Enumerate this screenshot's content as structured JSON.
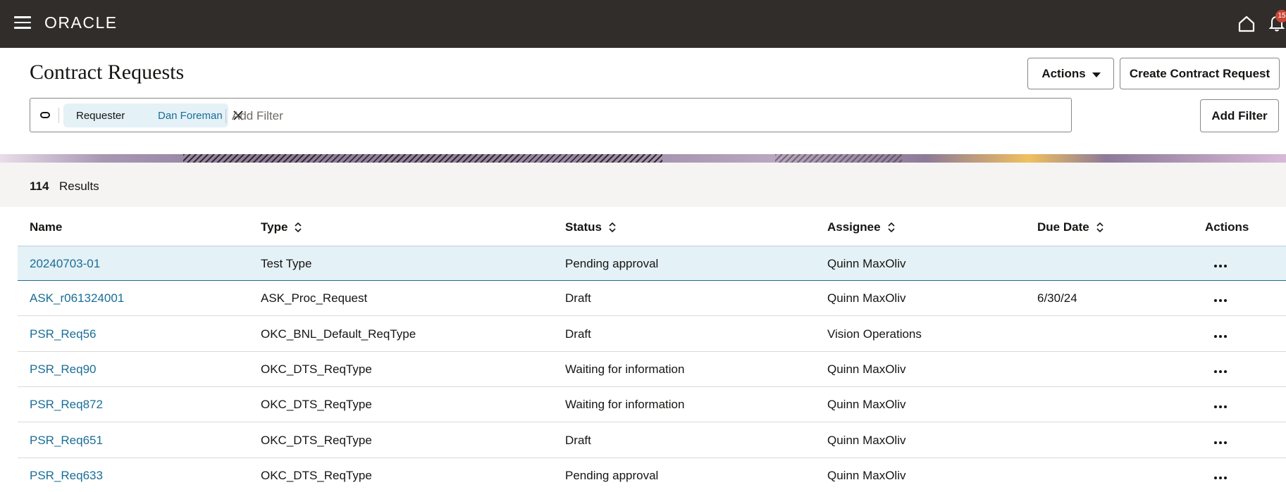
{
  "header": {
    "logo": "ORACLE",
    "notification_count": "15"
  },
  "page": {
    "title": "Contract Requests",
    "actions_label": "Actions",
    "create_label": "Create Contract Request",
    "add_filter_button": "Add Filter"
  },
  "filter": {
    "chip_label": "Requester",
    "chip_value": "Dan Foreman",
    "placeholder": "Add Filter"
  },
  "results": {
    "count": "114",
    "label": "Results"
  },
  "table": {
    "columns": [
      "Name",
      "Type",
      "Status",
      "Assignee",
      "Due Date",
      "Actions"
    ],
    "rows": [
      {
        "name": "20240703-01",
        "type": "Test Type",
        "status": "Pending approval",
        "assignee": "Quinn MaxOliv",
        "due": ""
      },
      {
        "name": "ASK_r061324001",
        "type": "ASK_Proc_Request",
        "status": "Draft",
        "assignee": "Quinn MaxOliv",
        "due": "6/30/24"
      },
      {
        "name": "PSR_Req56",
        "type": "OKC_BNL_Default_ReqType",
        "status": "Draft",
        "assignee": "Vision Operations",
        "due": ""
      },
      {
        "name": "PSR_Req90",
        "type": "OKC_DTS_ReqType",
        "status": "Waiting for information",
        "assignee": "Quinn MaxOliv",
        "due": ""
      },
      {
        "name": "PSR_Req872",
        "type": "OKC_DTS_ReqType",
        "status": "Waiting for information",
        "assignee": "Quinn MaxOliv",
        "due": ""
      },
      {
        "name": "PSR_Req651",
        "type": "OKC_DTS_ReqType",
        "status": "Draft",
        "assignee": "Quinn MaxOliv",
        "due": ""
      },
      {
        "name": "PSR_Req633",
        "type": "OKC_DTS_ReqType",
        "status": "Pending approval",
        "assignee": "Quinn MaxOliv",
        "due": ""
      }
    ]
  }
}
